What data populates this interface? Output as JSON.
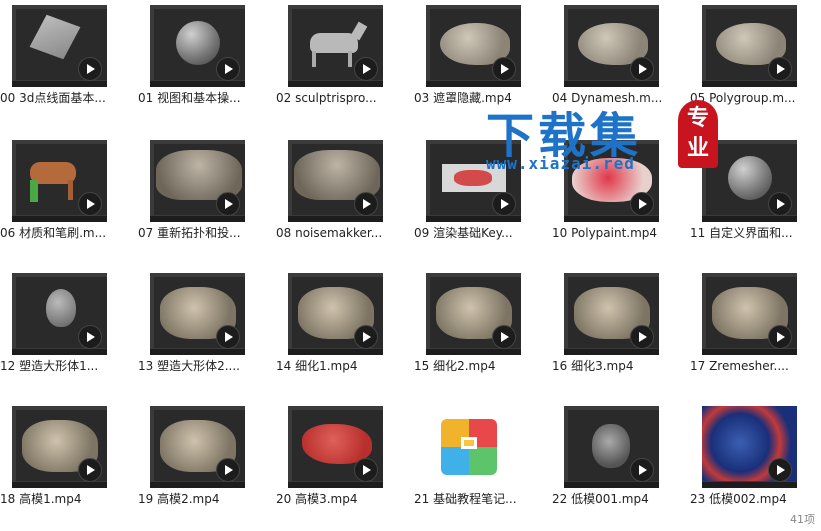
{
  "files": [
    {
      "label": "00 3d点线面基本...",
      "thumb": "cube"
    },
    {
      "label": "01 视图和基本操...",
      "thumb": "sphere"
    },
    {
      "label": "02 sculptrispro...",
      "thumb": "horse"
    },
    {
      "label": "03 遮罩隐藏.mp4",
      "thumb": "fish"
    },
    {
      "label": "04 Dynamesh.m...",
      "thumb": "fish"
    },
    {
      "label": "05 Polygroup.m...",
      "thumb": "fish"
    },
    {
      "label": "06 材质和笔刷.m...",
      "thumb": "horse-color"
    },
    {
      "label": "07 重新拓扑和投...",
      "thumb": "closeup"
    },
    {
      "label": "08 noisemakker...",
      "thumb": "closeup"
    },
    {
      "label": "09 渲染基础Key...",
      "thumb": "ui-red"
    },
    {
      "label": "10 Polypaint.mp4",
      "thumb": "red-paint"
    },
    {
      "label": "11 自定义界面和...",
      "thumb": "sphere"
    },
    {
      "label": "12 塑造大形体1...",
      "thumb": "egg"
    },
    {
      "label": "13 塑造大形体2....",
      "thumb": "creature"
    },
    {
      "label": "14 细化1.mp4",
      "thumb": "creature"
    },
    {
      "label": "15 细化2.mp4",
      "thumb": "creature"
    },
    {
      "label": "16 细化3.mp4",
      "thumb": "creature"
    },
    {
      "label": "17 Zremesher....",
      "thumb": "creature"
    },
    {
      "label": "18 高模1.mp4",
      "thumb": "creature"
    },
    {
      "label": "19 高模2.mp4",
      "thumb": "creature"
    },
    {
      "label": "20 高模3.mp4",
      "thumb": "red-creature"
    },
    {
      "label": "21 基础教程笔记...",
      "thumb": "archive"
    },
    {
      "label": "22 低模001.mp4",
      "thumb": "creature-small"
    },
    {
      "label": "23 低模002.mp4",
      "thumb": "uv"
    }
  ],
  "watermark": {
    "title": "下载集",
    "url": "www.xiazai.red",
    "badge": "专业"
  },
  "status": {
    "count": "41项"
  }
}
